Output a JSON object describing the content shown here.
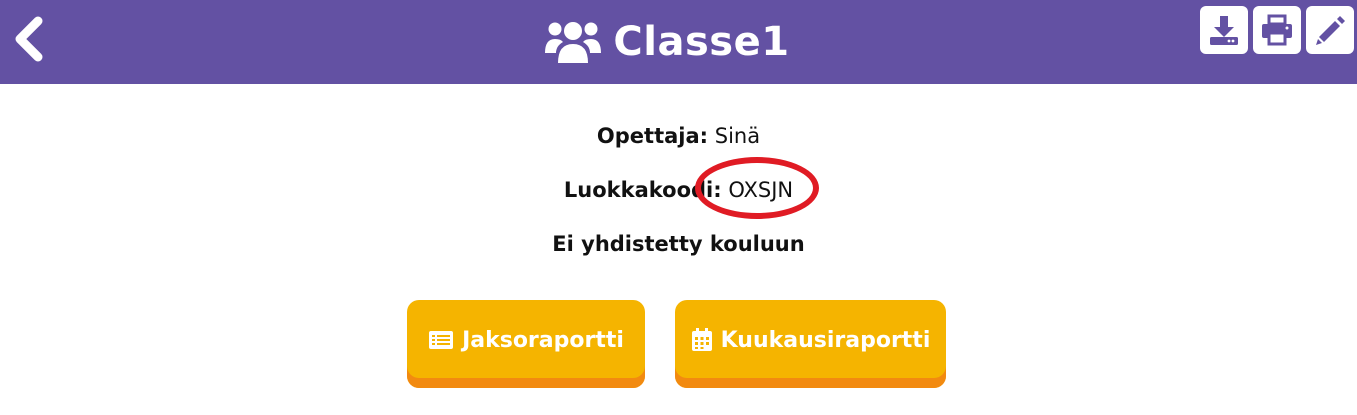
{
  "header": {
    "title": "Classe1",
    "icons": {
      "back": "chevron-left-icon",
      "title": "users-icon",
      "download": "download-icon",
      "print": "print-icon",
      "edit": "pencil-icon"
    }
  },
  "info": {
    "teacher_label": "Opettaja:",
    "teacher_value": "Sinä",
    "code_label": "Luokkakoodi:",
    "code_value": "OXSJN",
    "school_status": "Ei yhdistetty kouluun"
  },
  "buttons": {
    "period_report": "Jaksoraportti",
    "monthly_report": "Kuukausiraportti"
  },
  "colors": {
    "header": "#6351a3",
    "button": "#f5b400",
    "button_shadow": "#f28a10",
    "highlight_ring": "#e01b24"
  }
}
